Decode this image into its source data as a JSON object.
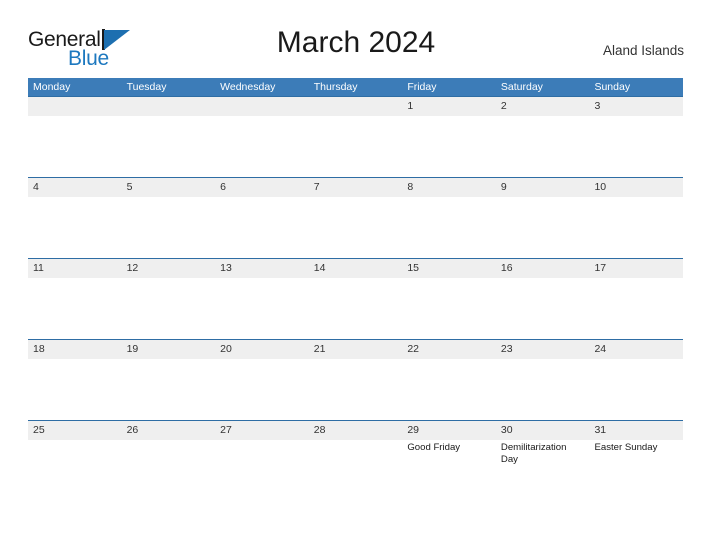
{
  "brand": {
    "name_part1": "General",
    "name_part2": "Blue"
  },
  "header": {
    "title": "March 2024",
    "region": "Aland Islands"
  },
  "calendar": {
    "weekdays": [
      "Monday",
      "Tuesday",
      "Wednesday",
      "Thursday",
      "Friday",
      "Saturday",
      "Sunday"
    ],
    "accent_color": "#3c7cb8",
    "row_band_color": "#efefef",
    "weeks": [
      {
        "days": [
          {
            "num": "",
            "events": []
          },
          {
            "num": "",
            "events": []
          },
          {
            "num": "",
            "events": []
          },
          {
            "num": "",
            "events": []
          },
          {
            "num": "1",
            "events": []
          },
          {
            "num": "2",
            "events": []
          },
          {
            "num": "3",
            "events": []
          }
        ]
      },
      {
        "days": [
          {
            "num": "4",
            "events": []
          },
          {
            "num": "5",
            "events": []
          },
          {
            "num": "6",
            "events": []
          },
          {
            "num": "7",
            "events": []
          },
          {
            "num": "8",
            "events": []
          },
          {
            "num": "9",
            "events": []
          },
          {
            "num": "10",
            "events": []
          }
        ]
      },
      {
        "days": [
          {
            "num": "11",
            "events": []
          },
          {
            "num": "12",
            "events": []
          },
          {
            "num": "13",
            "events": []
          },
          {
            "num": "14",
            "events": []
          },
          {
            "num": "15",
            "events": []
          },
          {
            "num": "16",
            "events": []
          },
          {
            "num": "17",
            "events": []
          }
        ]
      },
      {
        "days": [
          {
            "num": "18",
            "events": []
          },
          {
            "num": "19",
            "events": []
          },
          {
            "num": "20",
            "events": []
          },
          {
            "num": "21",
            "events": []
          },
          {
            "num": "22",
            "events": []
          },
          {
            "num": "23",
            "events": []
          },
          {
            "num": "24",
            "events": []
          }
        ]
      },
      {
        "days": [
          {
            "num": "25",
            "events": []
          },
          {
            "num": "26",
            "events": []
          },
          {
            "num": "27",
            "events": []
          },
          {
            "num": "28",
            "events": []
          },
          {
            "num": "29",
            "events": [
              "Good Friday"
            ]
          },
          {
            "num": "30",
            "events": [
              "Demilitarization Day"
            ]
          },
          {
            "num": "31",
            "events": [
              "Easter Sunday"
            ]
          }
        ]
      }
    ]
  }
}
